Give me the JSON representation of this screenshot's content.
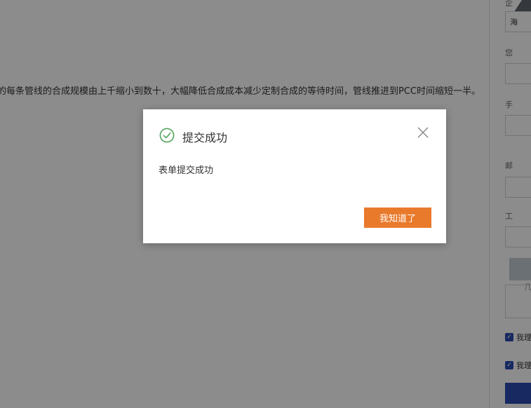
{
  "background": {
    "intro_text": "的每条管线的合成规模由上千缩小到数十，大幅降低合成成本减少定制合成的等待时间，管线推进到PCC时间缩短一半。",
    "side_panel": {
      "top_label": "企",
      "select_text": "海",
      "labels": [
        "您",
        "手",
        "邮",
        "工"
      ],
      "placeholder_glyph": "几",
      "checkbox_labels": [
        "我理",
        "我理"
      ]
    }
  },
  "modal": {
    "title": "提交成功",
    "message": "表单提交成功",
    "ok_label": "我知道了",
    "icons": {
      "status": "check-circle-icon",
      "close": "close-icon"
    }
  },
  "colors": {
    "success": "#52a35c",
    "accent": "#e97a2b",
    "overlay": "rgba(0,0,0,0.45)",
    "brand": "#2a4bb0"
  }
}
